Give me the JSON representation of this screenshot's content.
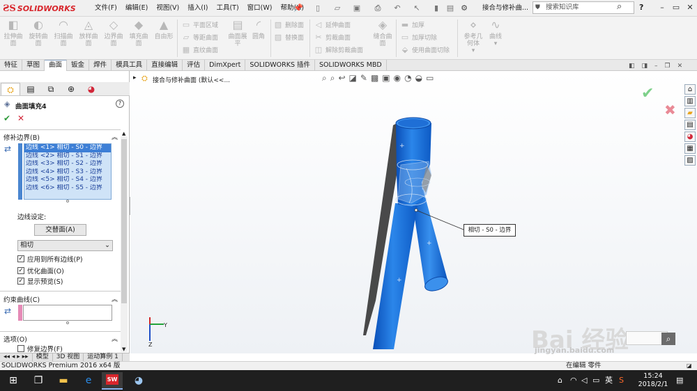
{
  "app": {
    "brand": "SOLIDWORKS",
    "title": "接合与修补曲...",
    "search_placeholder": "搜索知识库"
  },
  "menu": [
    "文件(F)",
    "编辑(E)",
    "视图(V)",
    "插入(I)",
    "工具(T)",
    "窗口(W)",
    "帮助(H)"
  ],
  "ribbon": {
    "large": [
      "拉伸曲面",
      "旋转曲面",
      "扫描曲面",
      "放样曲面",
      "边界曲面",
      "填充曲面",
      "自由形"
    ],
    "group1": [
      "平面区域",
      "等距曲面",
      "直纹曲面"
    ],
    "single1": "曲面展平",
    "single2": "圆角",
    "group2": [
      "删除面",
      "替换面"
    ],
    "group3": [
      "延伸曲面",
      "剪裁曲面",
      "解除剪裁曲面"
    ],
    "single3": "缝合曲面",
    "group4": [
      "加厚",
      "加厚切除",
      "使用曲面切除"
    ],
    "single4": "参考几何体",
    "single5": "曲线"
  },
  "tabs": [
    "特征",
    "草图",
    "曲面",
    "钣金",
    "焊件",
    "模具工具",
    "直接编辑",
    "评估",
    "DimXpert",
    "SOLIDWORKS 插件",
    "SOLIDWORKS MBD"
  ],
  "active_tab": "曲面",
  "tree_header": "接合与修补曲面 (默认<<...",
  "property": {
    "title": "曲面填充4",
    "section_boundary": "修补边界(B)",
    "edges": [
      "边线 <1> 相切 - S0 - 边界",
      "边线 <2> 相切 - S1 - 边界",
      "边线 <3> 相切 - S2 - 边界",
      "边线 <4> 相切 - S3 - 边界",
      "边线 <5> 相切 - S4 - 边界",
      "边线 <6> 相切 - S5 - 边界"
    ],
    "edge_settings_label": "边线设定:",
    "alternate_button": "交替面(A)",
    "mode_value": "相切",
    "chk_apply_all": "应用到所有边线(P)",
    "chk_optimize": "优化曲面(O)",
    "chk_preview": "显示预览(S)",
    "section_constraint": "约束曲线(C)",
    "section_options": "选项(O)",
    "chk_repair": "修复边界(F)"
  },
  "callout": "相切 - S0 - 边界",
  "bottom_tabs": [
    "模型",
    "3D 视图",
    "运动算例 1"
  ],
  "status_text": "SOLIDWORKS Premium 2016 x64 版",
  "status_right": "在编辑 零件",
  "taskbar": {
    "ime": "英",
    "time": "15:24",
    "date": "2018/2/1"
  },
  "watermark": {
    "main": "Bai 经验",
    "sub": "jingyan.baidu.com"
  },
  "colors": {
    "accent": "#1e73d8",
    "brand": "#d8262c",
    "ok": "#2e9a3a",
    "cancel": "#d2283a"
  }
}
